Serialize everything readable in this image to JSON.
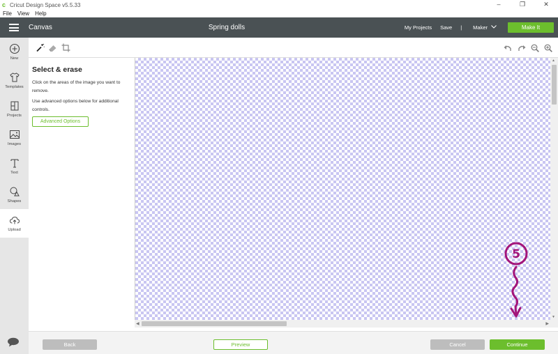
{
  "titlebar": {
    "title": "Cricut Design Space  v5.5.33",
    "minimize": "–",
    "maximize": "❐",
    "close": "✕"
  },
  "menu": [
    "File",
    "View",
    "Help"
  ],
  "header": {
    "section": "Canvas",
    "project_title": "Spring dolls",
    "my_projects": "My Projects",
    "save": "Save",
    "separator": "|",
    "machine": "Maker",
    "make_it": "Make It"
  },
  "nav": [
    {
      "label": "New",
      "icon": "plus-circle-icon"
    },
    {
      "label": "Templates",
      "icon": "tshirt-icon"
    },
    {
      "label": "Projects",
      "icon": "projects-icon"
    },
    {
      "label": "Images",
      "icon": "image-icon"
    },
    {
      "label": "Text",
      "icon": "text-icon"
    },
    {
      "label": "Shapes",
      "icon": "shapes-icon"
    },
    {
      "label": "Upload",
      "icon": "upload-cloud-icon"
    }
  ],
  "active_nav": "Upload",
  "panel": {
    "heading": "Select & erase",
    "instruction": "Click on the areas of the image you want to remove.",
    "advanced_hint": "Use advanced options below for additional controls.",
    "advanced_button": "Advanced Options"
  },
  "annotation": {
    "number": "5"
  },
  "footer": {
    "back": "Back",
    "preview": "Preview",
    "cancel": "Cancel",
    "continue": "Continue"
  },
  "colors": {
    "header_bg": "#4a5154",
    "accent": "#6cbe2d",
    "checker": "#c9c6f2",
    "annotation": "#a3157a",
    "nav_bg": "#e6e6e6"
  }
}
